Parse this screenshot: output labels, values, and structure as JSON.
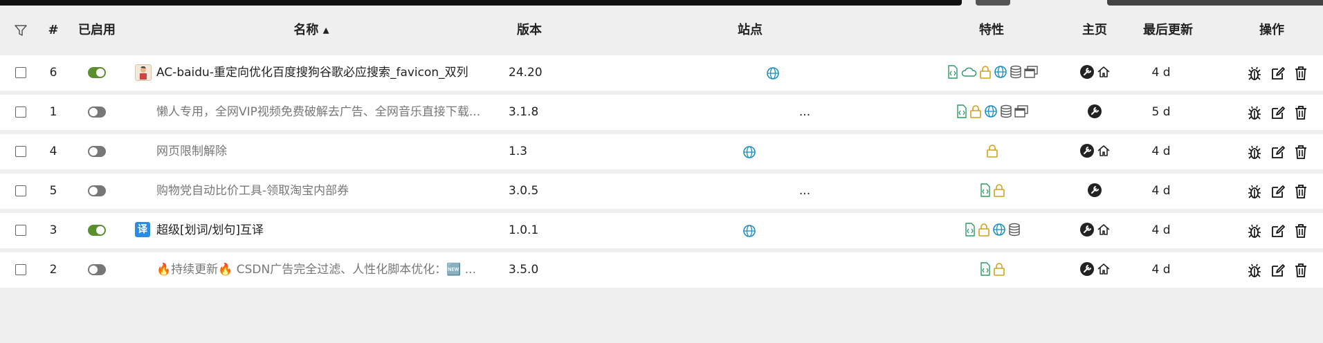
{
  "columns": {
    "filter_icon": "filter-icon",
    "index": "#",
    "enabled": "已启用",
    "name": "名称 ▴",
    "version": "版本",
    "sites": "站点",
    "features": "特性",
    "homepage": "主页",
    "updated": "最后更新",
    "actions": "操作"
  },
  "colors": {
    "accent_green": "#5a8f2e",
    "feature_green": "#2f9a67",
    "feature_gold": "#d4a017",
    "feature_blue": "#1a8fc0",
    "row_bg": "#ffffff",
    "page_bg": "#efefef"
  },
  "rows": [
    {
      "index": "6",
      "enabled": true,
      "name": "AC-baidu-重定向优化百度搜狗谷歌必应搜索_favicon_双列",
      "version": "24.20",
      "site": "globe",
      "features": [
        "code-file",
        "cloud",
        "lock",
        "globe",
        "database",
        "windows"
      ],
      "home": [
        "wrench",
        "home"
      ],
      "updated": "4 d",
      "icon": "avatar"
    },
    {
      "index": "1",
      "enabled": false,
      "name": "懒人专用，全网VIP视频免费破解去广告、全网音乐直接下载...",
      "version": "3.1.8",
      "site": "...",
      "features": [
        "code-file",
        "lock",
        "globe",
        "database",
        "windows"
      ],
      "home": [
        "wrench"
      ],
      "updated": "5 d",
      "icon": "none"
    },
    {
      "index": "4",
      "enabled": false,
      "name": "网页限制解除",
      "version": "1.3",
      "site": "globe",
      "features": [
        "lock"
      ],
      "home": [
        "wrench",
        "home"
      ],
      "updated": "4 d",
      "icon": "none"
    },
    {
      "index": "5",
      "enabled": false,
      "name": "购物党自动比价工具-领取淘宝内部券",
      "version": "3.0.5",
      "site": "...",
      "features": [
        "code-file",
        "lock"
      ],
      "home": [
        "wrench"
      ],
      "updated": "4 d",
      "icon": "none"
    },
    {
      "index": "3",
      "enabled": true,
      "name": "超级[划词/划句]互译",
      "version": "1.0.1",
      "site": "globe",
      "features": [
        "code-file",
        "lock",
        "globe",
        "database"
      ],
      "home": [
        "wrench",
        "home"
      ],
      "updated": "4 d",
      "icon": "translate",
      "icon_text": "译"
    },
    {
      "index": "2",
      "enabled": false,
      "name": "🔥持续更新🔥 CSDN广告完全过滤、人性化脚本优化：🆕 ...",
      "version": "3.5.0",
      "site": "",
      "features": [
        "code-file",
        "lock"
      ],
      "home": [
        "wrench",
        "home"
      ],
      "updated": "4 d",
      "icon": "none"
    }
  ],
  "action_icons": [
    "bug-icon",
    "edit-icon",
    "trash-icon"
  ]
}
